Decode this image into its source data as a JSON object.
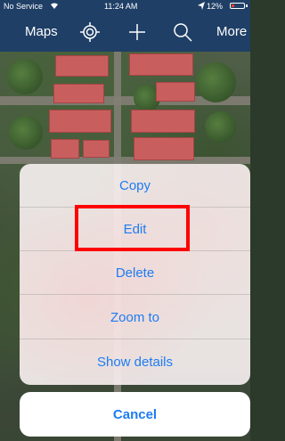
{
  "status_bar": {
    "carrier": "No Service",
    "time": "11:24 AM",
    "battery": "12%",
    "battery_color": "#ff3b30"
  },
  "navbar": {
    "maps_label": "Maps",
    "more_label": "More",
    "icons": [
      "locate-icon",
      "add-icon",
      "search-icon"
    ],
    "background": "#1f3f66"
  },
  "action_sheet": {
    "items": [
      {
        "label": "Copy"
      },
      {
        "label": "Edit"
      },
      {
        "label": "Delete"
      },
      {
        "label": "Zoom to"
      },
      {
        "label": "Show details"
      }
    ],
    "highlighted_item": "Edit",
    "highlight_color": "#ff0000",
    "cancel_label": "Cancel",
    "text_color": "#1e7cf2"
  }
}
